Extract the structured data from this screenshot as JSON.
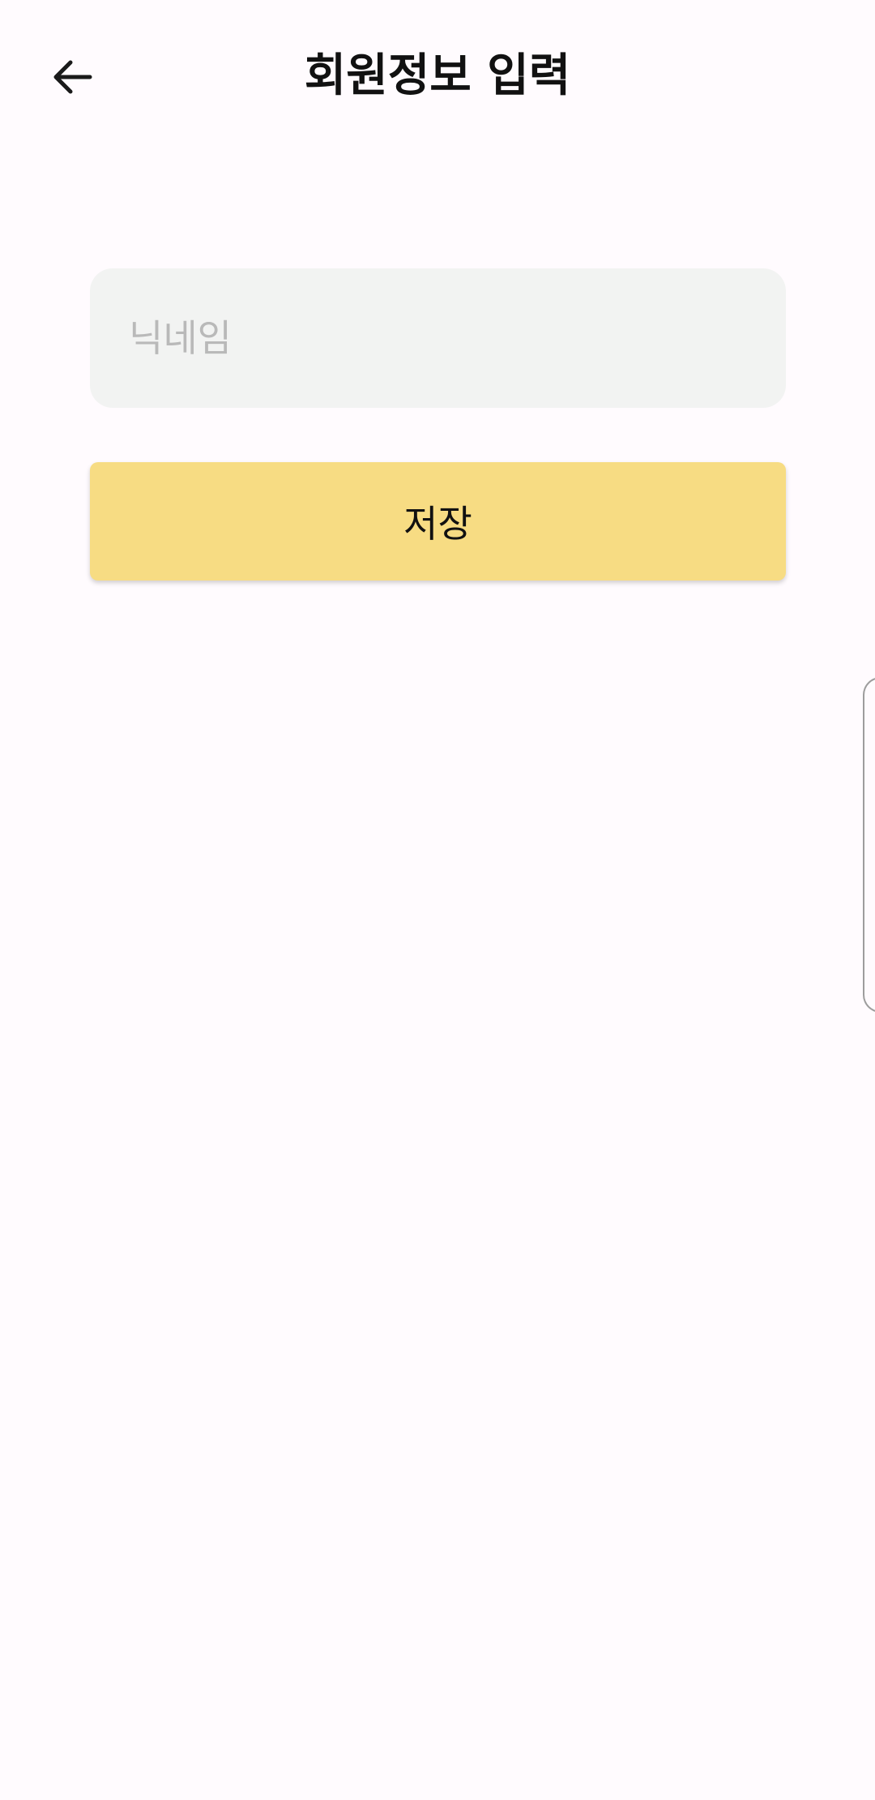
{
  "header": {
    "title": "회원정보 입력",
    "back_icon": "arrow-left-icon"
  },
  "form": {
    "nickname": {
      "placeholder": "닉네임",
      "value": ""
    },
    "save_button": {
      "label": "저장"
    }
  },
  "colors": {
    "background": "#fffbfe",
    "field_background": "#f2f3f2",
    "placeholder_text": "#b9b9b9",
    "primary_button": "#f7dc83",
    "text": "#111111"
  }
}
